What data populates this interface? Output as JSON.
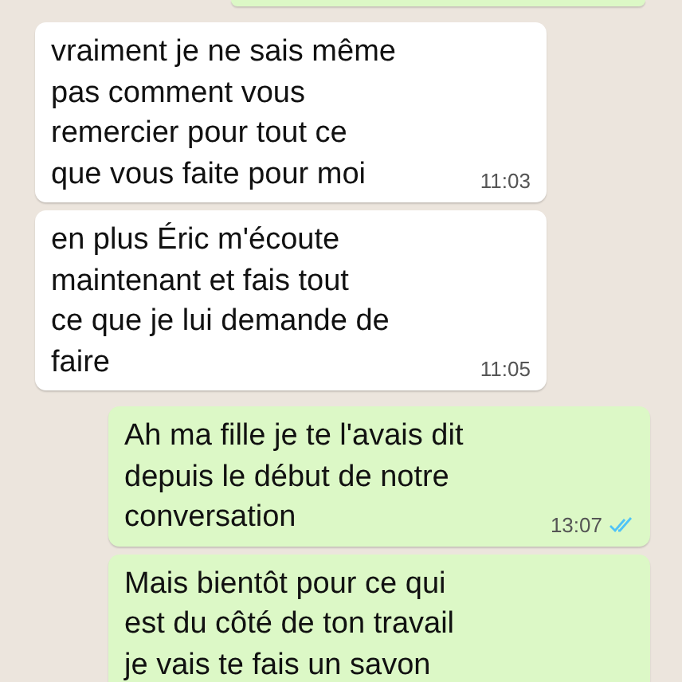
{
  "messages": [
    {
      "kind": "outgoing"
    },
    {
      "kind": "incoming",
      "text": "vraiment je ne sais même\npas comment vous\nremercier pour tout ce\nque vous faite pour moi",
      "time": "11:03"
    },
    {
      "kind": "incoming",
      "text": "en plus Éric m'écoute\nmaintenant et fais tout\nce que je lui demande de\nfaire",
      "time": "11:05"
    },
    {
      "kind": "outgoing",
      "text": "Ah ma fille je te l'avais dit\ndepuis le début de notre\nconversation",
      "time": "13:07",
      "read": true
    },
    {
      "kind": "outgoing",
      "text": "Mais bientôt pour ce qui\nest du côté de ton travail\nje vais te fais un savon"
    }
  ]
}
